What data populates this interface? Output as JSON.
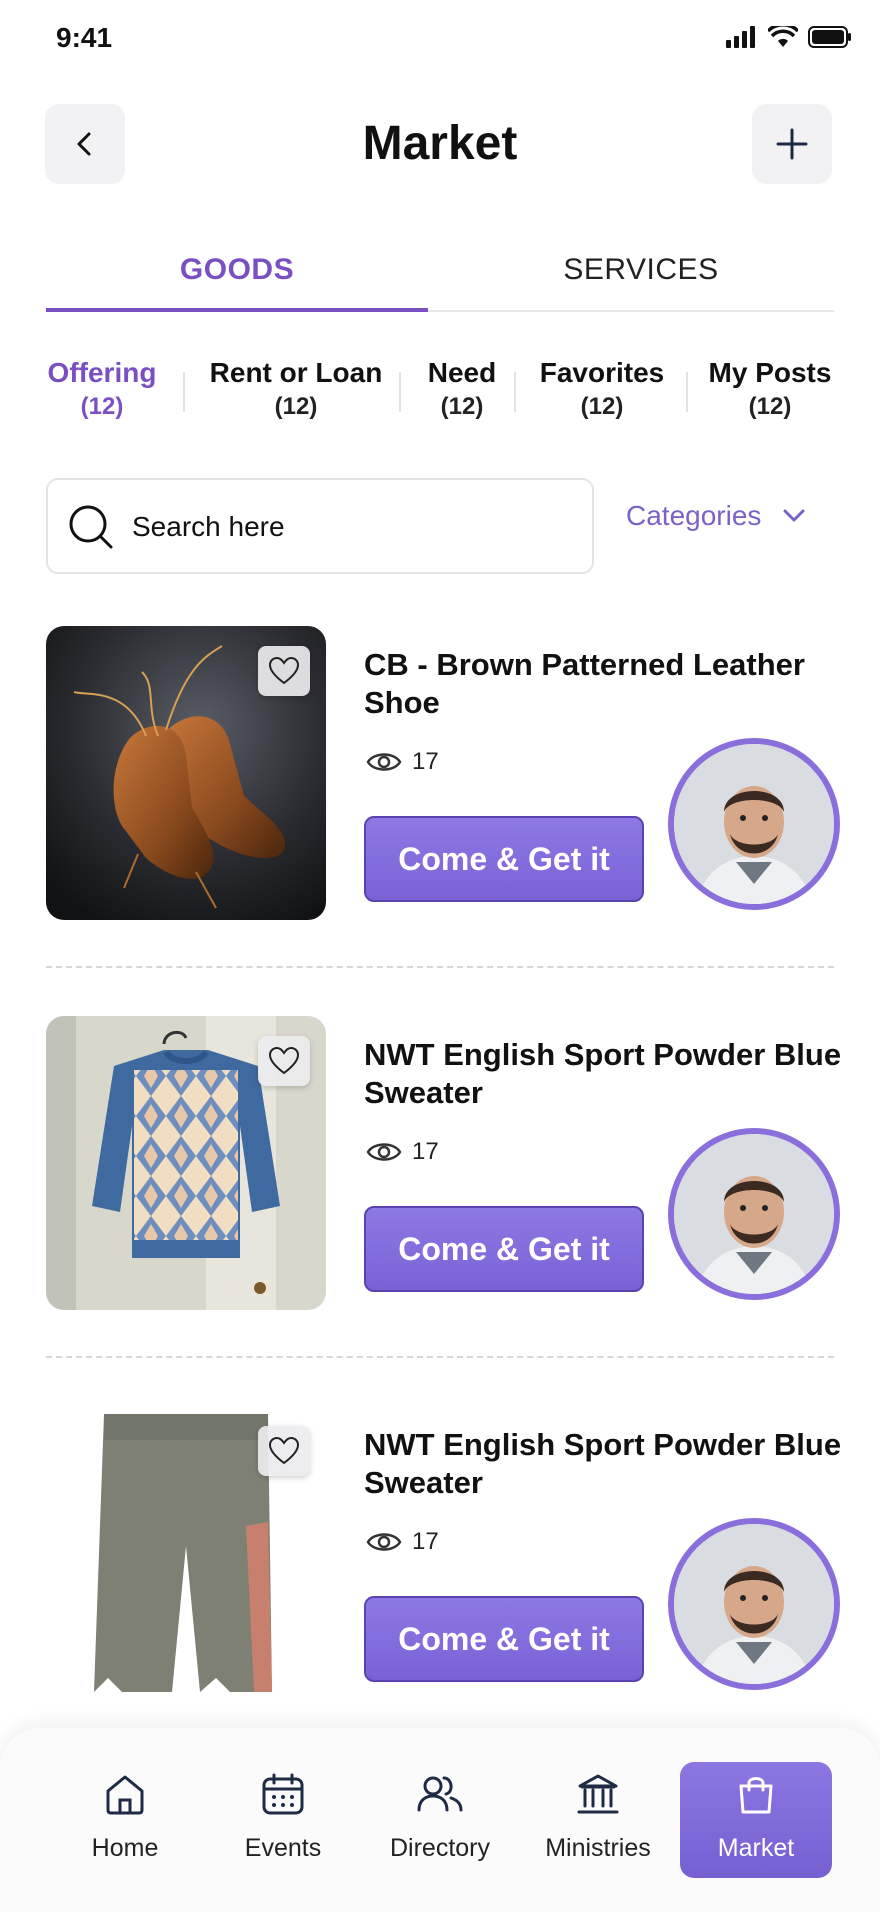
{
  "status_bar": {
    "time": "9:41"
  },
  "header": {
    "title": "Market"
  },
  "main_tabs": [
    {
      "label": "GOODS",
      "active": true
    },
    {
      "label": "SERVICES",
      "active": false
    }
  ],
  "sub_tabs": [
    {
      "label": "Offering",
      "count": "(12)",
      "active": true
    },
    {
      "label": "Rent or Loan",
      "count": "(12)",
      "active": false
    },
    {
      "label": "Need",
      "count": "(12)",
      "active": false
    },
    {
      "label": "Favorites",
      "count": "(12)",
      "active": false
    },
    {
      "label": "My Posts",
      "count": "(12)",
      "active": false
    }
  ],
  "search": {
    "placeholder": "Search here",
    "value": ""
  },
  "categories": {
    "label": "Categories"
  },
  "listings": [
    {
      "title": "CB - Brown Patterned Leather Shoe",
      "views": "17",
      "cta": "Come & Get it",
      "image": "brown-leather-shoes"
    },
    {
      "title": "NWT English Sport Powder Blue Sweater",
      "views": "17",
      "cta": "Come & Get it",
      "image": "argyle-sweater"
    },
    {
      "title": "NWT English Sport Powder Blue Sweater",
      "views": "17",
      "cta": "Come & Get it",
      "image": "grey-shorts"
    }
  ],
  "bottom_nav": [
    {
      "label": "Home",
      "icon": "home-icon",
      "active": false
    },
    {
      "label": "Events",
      "icon": "calendar-icon",
      "active": false
    },
    {
      "label": "Directory",
      "icon": "people-icon",
      "active": false
    },
    {
      "label": "Ministries",
      "icon": "building-icon",
      "active": false
    },
    {
      "label": "Market",
      "icon": "shopping-bag-icon",
      "active": true
    }
  ],
  "colors": {
    "accent": "#7a4fc4",
    "button": "#7a62d6",
    "avatar_ring": "#8a6fdc"
  }
}
